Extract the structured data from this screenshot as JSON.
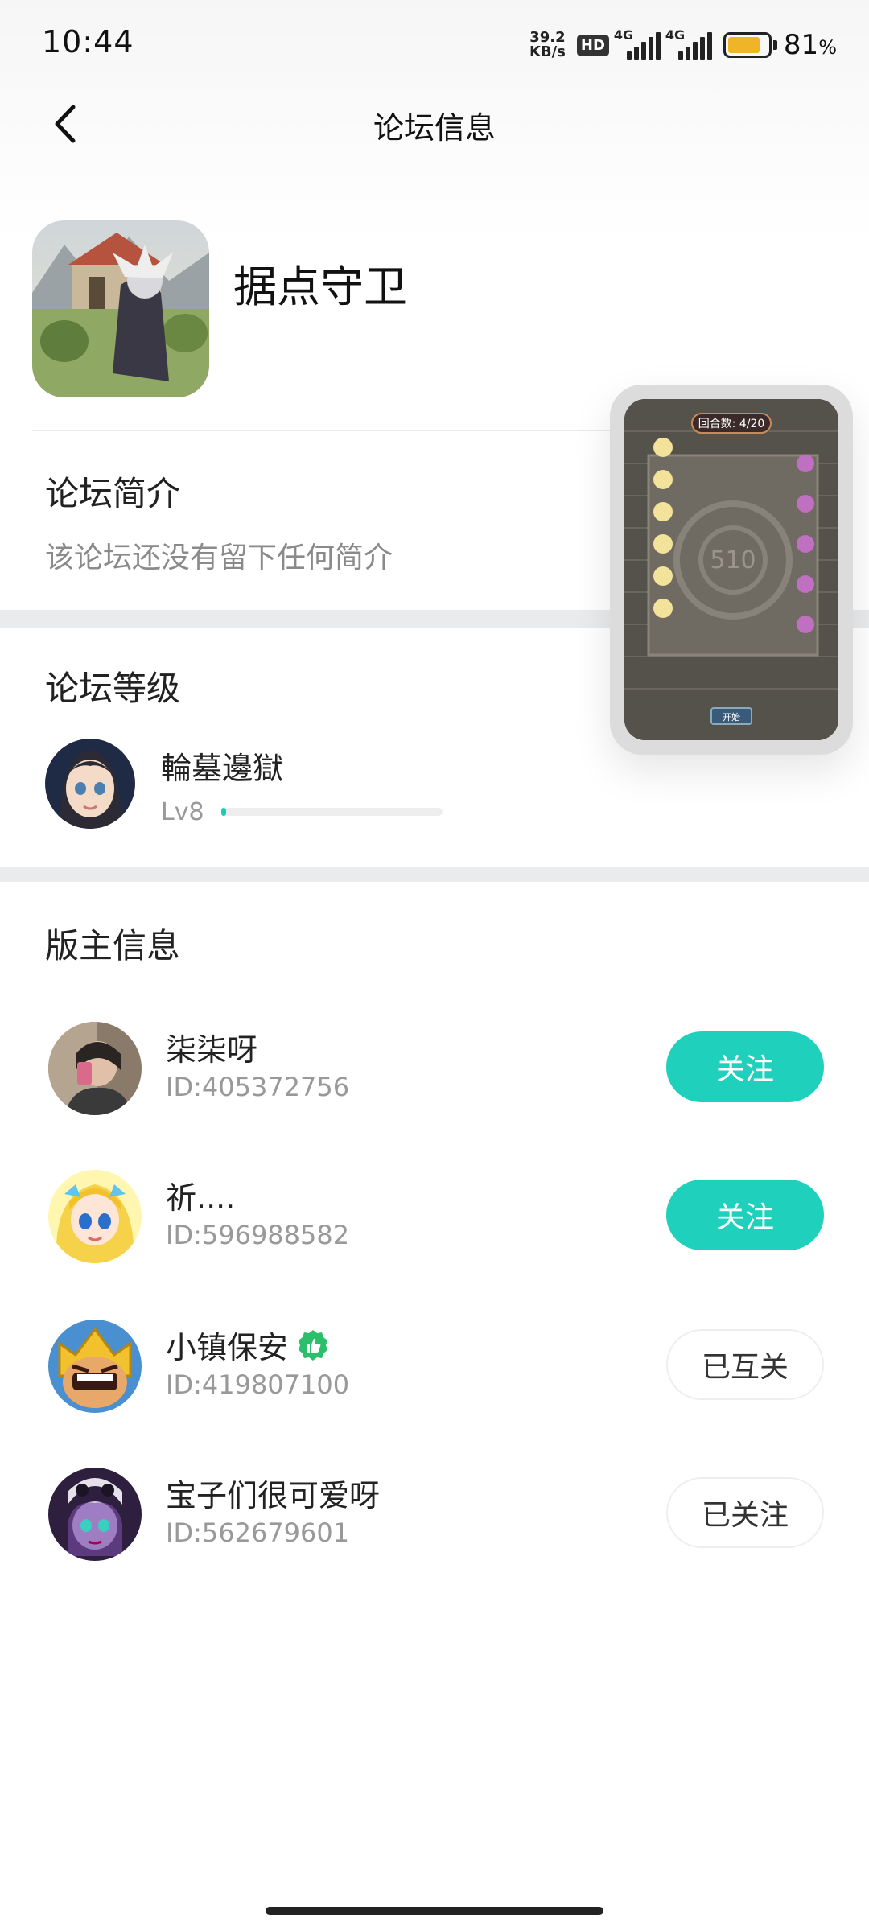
{
  "status_bar": {
    "time": "10:44",
    "net_speed_value": "39.2",
    "net_speed_unit": "KB/s",
    "hd_label": "HD",
    "signal1_label": "4G",
    "signal2_label": "4G",
    "battery_percent": "81",
    "battery_unit": "%",
    "battery_level": 0.81
  },
  "header": {
    "title": "论坛信息"
  },
  "forum": {
    "name": "据点守卫"
  },
  "intro": {
    "title": "论坛简介",
    "text": "该论坛还没有留下任何简介"
  },
  "level": {
    "title": "论坛等级",
    "user_name": "輪墓邊獄",
    "level_label": "Lv8",
    "progress": 0.02
  },
  "preview": {
    "round_label": "回合数: 4/20",
    "center_number": "510",
    "button_label": "开始"
  },
  "moderators": {
    "title": "版主信息",
    "items": [
      {
        "name": "柒柒呀",
        "id": "ID:405372756",
        "button": "关注"
      },
      {
        "name": "祈....",
        "id": "ID:596988582",
        "button": "关注"
      },
      {
        "name": "小镇保安",
        "id": "ID:419807100",
        "button": "已互关"
      },
      {
        "name": "宝子们很可爱呀",
        "id": "ID:562679601",
        "button": "已关注"
      }
    ]
  },
  "colors": {
    "accent": "#1fd1bd",
    "battery": "#f0b429"
  }
}
